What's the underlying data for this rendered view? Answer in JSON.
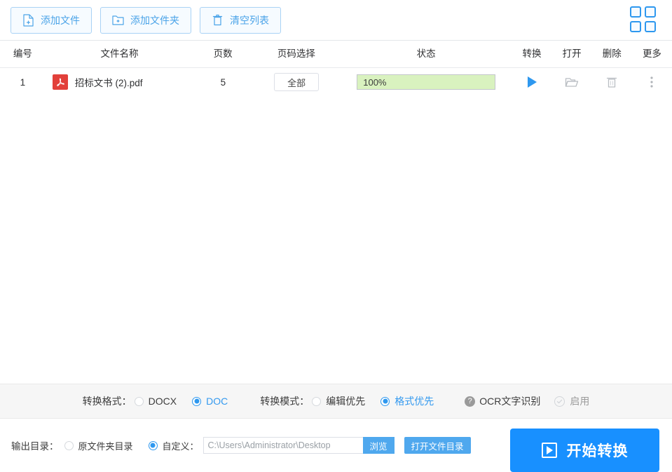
{
  "toolbar": {
    "buttons": [
      {
        "label": "添加文件",
        "icon": "file-plus-icon"
      },
      {
        "label": "添加文件夹",
        "icon": "folder-plus-icon"
      },
      {
        "label": "清空列表",
        "icon": "trash-icon"
      }
    ],
    "grid_view_icon": "grid-view-icon"
  },
  "table": {
    "columns": [
      {
        "key": "no",
        "label": "编号"
      },
      {
        "key": "name",
        "label": "文件名称"
      },
      {
        "key": "pages",
        "label": "页数"
      },
      {
        "key": "range",
        "label": "页码选择"
      },
      {
        "key": "status",
        "label": "状态"
      },
      {
        "key": "convert",
        "label": "转换"
      },
      {
        "key": "open",
        "label": "打开"
      },
      {
        "key": "delete",
        "label": "删除"
      },
      {
        "key": "more",
        "label": "更多"
      }
    ],
    "rows": [
      {
        "no": "1",
        "file_type_icon": "pdf-file-icon",
        "name": "招标文书 (2).pdf",
        "pages": "5",
        "range": "全部",
        "status_text": "100%",
        "status_percent": 100
      }
    ]
  },
  "options": {
    "format_label": "转换格式：",
    "format_options": [
      {
        "label": "DOCX",
        "selected": false
      },
      {
        "label": "DOC",
        "selected": true
      }
    ],
    "mode_label": "转换模式：",
    "mode_options": [
      {
        "label": "编辑优先",
        "selected": false
      },
      {
        "label": "格式优先",
        "selected": true
      }
    ],
    "ocr_help_icon": "question-mark-icon",
    "ocr_label": "OCR文字识别",
    "ocr_enable_label": "启用",
    "ocr_enabled": false
  },
  "output": {
    "label": "输出目录：",
    "choices": [
      {
        "label": "原文件夹目录",
        "selected": false
      },
      {
        "label": "自定义：",
        "selected": true
      }
    ],
    "path_value": "C:\\Users\\Administrator\\Desktop",
    "path_placeholder": "C:\\Users\\Administrator\\Desktop",
    "browse_label": "浏览",
    "open_folder_label": "打开文件目录"
  },
  "action": {
    "start_label": "开始转换",
    "start_icon": "play-square-icon"
  },
  "colors": {
    "accent": "#1890ff",
    "accent_light": "#4fa8ee",
    "progress_fill": "#d9f2bf",
    "pdf_red": "#e2403a",
    "band_bg": "#f6f6f6"
  }
}
